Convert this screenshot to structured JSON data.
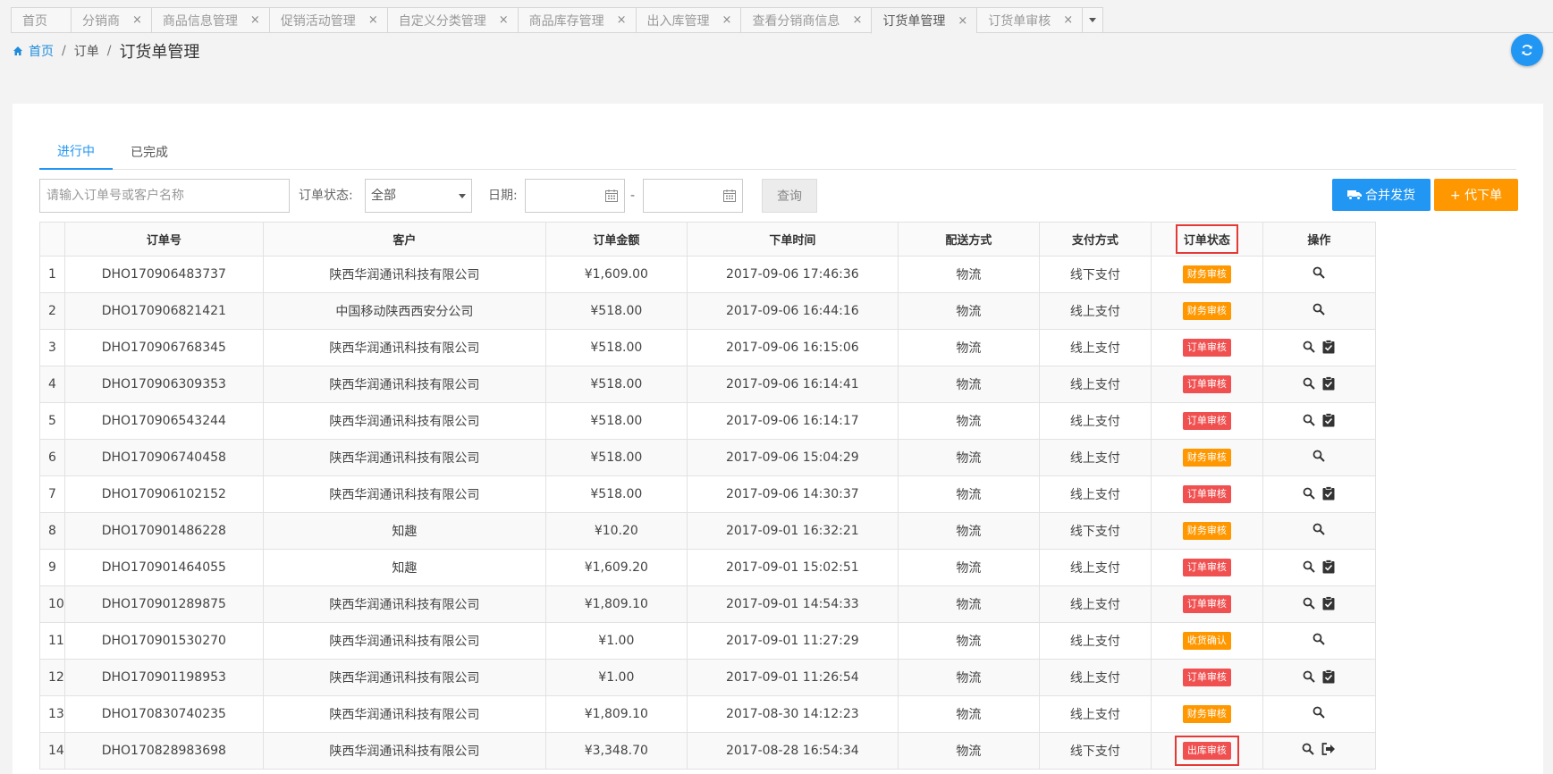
{
  "tabs": [
    {
      "label": "首页",
      "closable": false
    },
    {
      "label": "分销商",
      "closable": true
    },
    {
      "label": "商品信息管理",
      "closable": true
    },
    {
      "label": "促销活动管理",
      "closable": true
    },
    {
      "label": "自定义分类管理",
      "closable": true
    },
    {
      "label": "商品库存管理",
      "closable": true
    },
    {
      "label": "出入库管理",
      "closable": true
    },
    {
      "label": "查看分销商信息",
      "closable": true
    },
    {
      "label": "订货单管理",
      "closable": true,
      "active": true
    },
    {
      "label": "订货单审核",
      "closable": true
    }
  ],
  "breadcrumb": {
    "home": "首页",
    "mid": "订单",
    "current": "订货单管理"
  },
  "subtabs": [
    "进行中",
    "已完成"
  ],
  "filter": {
    "search_placeholder": "请输入订单号或客户名称",
    "status_label": "订单状态:",
    "status_value": "全部",
    "date_label": "日期:",
    "date_sep": "-",
    "query_label": "查询",
    "merge_label": "合并发货",
    "proxy_label": "+ 代下单"
  },
  "table": {
    "headers": [
      "订单号",
      "客户",
      "订单金额",
      "下单时间",
      "配送方式",
      "支付方式",
      "订单状态",
      "操作"
    ],
    "rows": [
      {
        "idx": "1",
        "order": "DHO170906483737",
        "customer": "陕西华润通讯科技有限公司",
        "amount": "¥1,609.00",
        "time": "2017-09-06 17:46:36",
        "ship": "物流",
        "pay": "线下支付",
        "status": "财务审核",
        "color": "orange",
        "ops": [
          "search"
        ]
      },
      {
        "idx": "2",
        "order": "DHO170906821421",
        "customer": "中国移动陕西西安分公司",
        "amount": "¥518.00",
        "time": "2017-09-06 16:44:16",
        "ship": "物流",
        "pay": "线上支付",
        "status": "财务审核",
        "color": "orange",
        "ops": [
          "search"
        ]
      },
      {
        "idx": "3",
        "order": "DHO170906768345",
        "customer": "陕西华润通讯科技有限公司",
        "amount": "¥518.00",
        "time": "2017-09-06 16:15:06",
        "ship": "物流",
        "pay": "线上支付",
        "status": "订单审核",
        "color": "red",
        "ops": [
          "search",
          "approve"
        ]
      },
      {
        "idx": "4",
        "order": "DHO170906309353",
        "customer": "陕西华润通讯科技有限公司",
        "amount": "¥518.00",
        "time": "2017-09-06 16:14:41",
        "ship": "物流",
        "pay": "线上支付",
        "status": "订单审核",
        "color": "red",
        "ops": [
          "search",
          "approve"
        ]
      },
      {
        "idx": "5",
        "order": "DHO170906543244",
        "customer": "陕西华润通讯科技有限公司",
        "amount": "¥518.00",
        "time": "2017-09-06 16:14:17",
        "ship": "物流",
        "pay": "线上支付",
        "status": "订单审核",
        "color": "red",
        "ops": [
          "search",
          "approve"
        ]
      },
      {
        "idx": "6",
        "order": "DHO170906740458",
        "customer": "陕西华润通讯科技有限公司",
        "amount": "¥518.00",
        "time": "2017-09-06 15:04:29",
        "ship": "物流",
        "pay": "线上支付",
        "status": "财务审核",
        "color": "orange",
        "ops": [
          "search"
        ]
      },
      {
        "idx": "7",
        "order": "DHO170906102152",
        "customer": "陕西华润通讯科技有限公司",
        "amount": "¥518.00",
        "time": "2017-09-06 14:30:37",
        "ship": "物流",
        "pay": "线上支付",
        "status": "订单审核",
        "color": "red",
        "ops": [
          "search",
          "approve"
        ]
      },
      {
        "idx": "8",
        "order": "DHO170901486228",
        "customer": "知趣",
        "amount": "¥10.20",
        "time": "2017-09-01 16:32:21",
        "ship": "物流",
        "pay": "线下支付",
        "status": "财务审核",
        "color": "orange",
        "ops": [
          "search"
        ]
      },
      {
        "idx": "9",
        "order": "DHO170901464055",
        "customer": "知趣",
        "amount": "¥1,609.20",
        "time": "2017-09-01 15:02:51",
        "ship": "物流",
        "pay": "线上支付",
        "status": "订单审核",
        "color": "red",
        "ops": [
          "search",
          "approve"
        ]
      },
      {
        "idx": "10",
        "order": "DHO170901289875",
        "customer": "陕西华润通讯科技有限公司",
        "amount": "¥1,809.10",
        "time": "2017-09-01 14:54:33",
        "ship": "物流",
        "pay": "线上支付",
        "status": "订单审核",
        "color": "red",
        "ops": [
          "search",
          "approve"
        ]
      },
      {
        "idx": "11",
        "order": "DHO170901530270",
        "customer": "陕西华润通讯科技有限公司",
        "amount": "¥1.00",
        "time": "2017-09-01 11:27:29",
        "ship": "物流",
        "pay": "线上支付",
        "status": "收货确认",
        "color": "orange",
        "ops": [
          "search"
        ]
      },
      {
        "idx": "12",
        "order": "DHO170901198953",
        "customer": "陕西华润通讯科技有限公司",
        "amount": "¥1.00",
        "time": "2017-09-01 11:26:54",
        "ship": "物流",
        "pay": "线上支付",
        "status": "订单审核",
        "color": "red",
        "ops": [
          "search",
          "approve"
        ]
      },
      {
        "idx": "13",
        "order": "DHO170830740235",
        "customer": "陕西华润通讯科技有限公司",
        "amount": "¥1,809.10",
        "time": "2017-08-30 14:12:23",
        "ship": "物流",
        "pay": "线上支付",
        "status": "财务审核",
        "color": "orange",
        "ops": [
          "search"
        ]
      },
      {
        "idx": "14",
        "order": "DHO170828983698",
        "customer": "陕西华润通讯科技有限公司",
        "amount": "¥3,348.70",
        "time": "2017-08-28 16:54:34",
        "ship": "物流",
        "pay": "线下支付",
        "status": "出库审核",
        "color": "red",
        "ops": [
          "search",
          "outbound"
        ],
        "highlight": true
      }
    ]
  }
}
